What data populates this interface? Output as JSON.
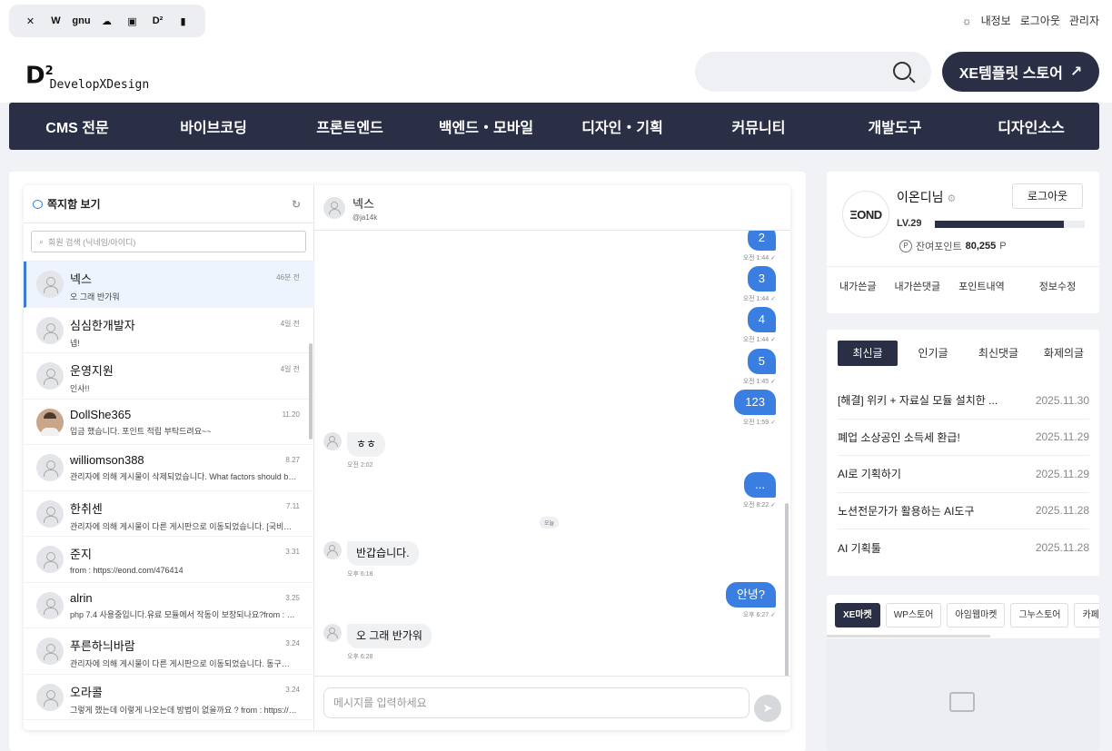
{
  "topbar": {
    "sites": [
      "✕",
      "W",
      "gnu",
      "☁",
      "▣",
      "D²",
      "▮"
    ],
    "theme_icon": "☼",
    "links": [
      "내정보",
      "로그아웃",
      "관리자"
    ]
  },
  "header": {
    "logo_mark": "D",
    "logo_sup": "2",
    "logo_text": "DevelopXDesign",
    "store_button": "XE템플릿 스토어",
    "store_arrow": "↗"
  },
  "nav": [
    "CMS 전문",
    "바이브코딩",
    "프론트엔드",
    "백엔드・모바일",
    "디자인・기획",
    "커뮤니티",
    "개발도구",
    "디자인소스"
  ],
  "messenger": {
    "title": "쪽지함 보기",
    "refresh_icon": "↻",
    "search_placeholder": "회원 검색 (닉네임/아이디)",
    "search_icon": "⌕",
    "conversations": [
      {
        "name": "넥스",
        "preview": "오 그래 반가워",
        "time": "46분 전"
      },
      {
        "name": "심심한개발자",
        "preview": "넵!",
        "time": "4일 전"
      },
      {
        "name": "운영지원",
        "preview": "인사!!",
        "time": "4일 전"
      },
      {
        "name": "DollShe365",
        "preview": "입금 했습니다. 포인트 적립 부탁드려요~~",
        "time": "11.20"
      },
      {
        "name": "williomson388",
        "preview": "관리자에 의해 게시물이 삭제되었습니다. What factors should bu...",
        "time": "8.27"
      },
      {
        "name": "한취센",
        "preview": "관리자에 의해 게시물이 다른 게시판으로 이동되었습니다. [국비교육] ...",
        "time": "7.11"
      },
      {
        "name": "준지",
        "preview": "from : https://eond.com/476414",
        "time": "3.31"
      },
      {
        "name": "alrin",
        "preview": "php 7.4 사용중입니다.유료 모듈에서 작동이 보장되나요?from : htt...",
        "time": "3.25"
      },
      {
        "name": "푸른하늬바람",
        "preview": "관리자에 의해 게시물이 다른 게시판으로 이동되었습니다. 동구에디터 ...",
        "time": "3.24"
      },
      {
        "name": "오라콜",
        "preview": "그렇게 했는데 이렇게 나오는데 방법이 없을까요 ? from : https://eo...",
        "time": "3.24"
      }
    ],
    "chat_name": "넥스",
    "chat_id": "@ja14k",
    "mine": [
      {
        "text": "2",
        "time": "오전 1:44 ✓"
      },
      {
        "text": "3",
        "time": "오전 1:44 ✓"
      },
      {
        "text": "4",
        "time": "오전 1:44 ✓"
      },
      {
        "text": "5",
        "time": "오전 1:45 ✓"
      },
      {
        "text": "123",
        "time": "오전 1:59 ✓"
      },
      {
        "text": "...",
        "time": "오전 8:22 ✓"
      },
      {
        "text": "안녕?",
        "time": "오후 6:27 ✓"
      }
    ],
    "theirs": [
      {
        "text": "ㅎㅎ",
        "time": "오전 2:02"
      },
      {
        "text": "반갑습니다.",
        "time": "오후 6:18"
      },
      {
        "text": "오 그래 반가워",
        "time": "오후 6:28"
      }
    ],
    "day_label": "오늘",
    "input_placeholder": "메시지를 입력하세요",
    "send_icon": "➤"
  },
  "profile": {
    "avatar_text": "ΞOND",
    "name": "이온디님",
    "settings_icon": "⚙",
    "logout": "로그아웃",
    "level": "LV.29",
    "level_progress": 0.86,
    "points_label": "잔여포인트",
    "points_icon": "P",
    "points_value": "80,255",
    "points_unit": "P",
    "links": [
      "내가쓴글",
      "내가쓴댓글",
      "포인트내역",
      "정보수정"
    ]
  },
  "posts": {
    "tabs": [
      "최신글",
      "인기글",
      "최신댓글",
      "화제의글"
    ],
    "items": [
      {
        "title": "[해결] 위키 + 자료실 모듈 설치한 ...",
        "date": "2025.11.30"
      },
      {
        "title": "폐업 소상공인 소득세 환급!",
        "date": "2025.11.29"
      },
      {
        "title": "AI로 기획하기",
        "date": "2025.11.29"
      },
      {
        "title": "노션전문가가 활용하는 AI도구",
        "date": "2025.11.28"
      },
      {
        "title": "AI 기획툴",
        "date": "2025.11.28"
      }
    ]
  },
  "market": {
    "tabs": [
      "XE마켓",
      "WP스토어",
      "아임웹마켓",
      "그누스토어",
      "카페"
    ]
  },
  "colors": {
    "brand": "#2b2f45",
    "accent": "#3b7ee2"
  }
}
